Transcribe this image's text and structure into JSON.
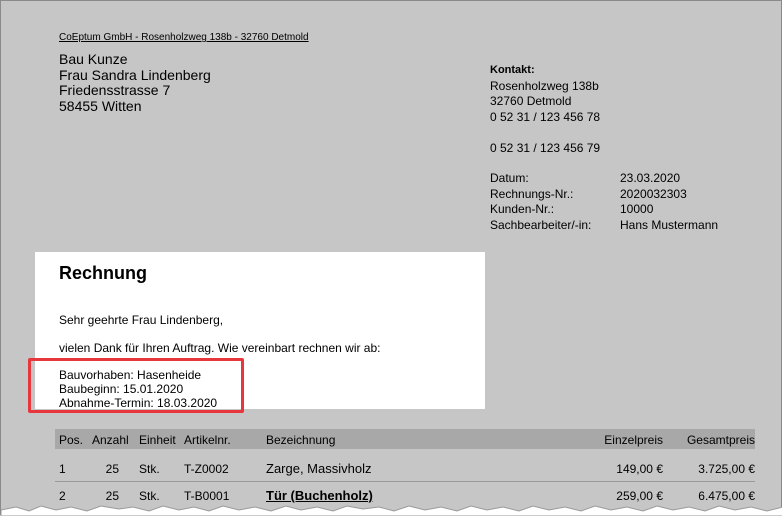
{
  "sender_line": "CoEptum GmbH - Rosenholzweg 138b - 32760 Detmold",
  "recipient": {
    "company": "Bau Kunze",
    "person": "Frau Sandra Lindenberg",
    "street": "Friedensstrasse 7",
    "city": "58455 Witten"
  },
  "contact": {
    "title": "Kontakt:",
    "street": "Rosenholzweg 138b",
    "city": "32760 Detmold",
    "phone": "0 52 31 / 123 456 78",
    "fax": "0 52 31 / 123 456 79"
  },
  "meta": [
    {
      "label": "Datum:",
      "value": "23.03.2020"
    },
    {
      "label": "Rechnungs-Nr.:",
      "value": "2020032303"
    },
    {
      "label": "Kunden-Nr.:",
      "value": "10000"
    },
    {
      "label": "Sachbearbeiter/-in:",
      "value": "Hans Mustermann"
    }
  ],
  "document": {
    "title": "Rechnung",
    "salutation": "Sehr geehrte Frau Lindenberg,",
    "intro": "vielen Dank für Ihren Auftrag. Wie vereinbart rechnen wir ab:",
    "project": "Bauvorhaben: Hasenheide",
    "start": "Baubeginn: 15.01.2020",
    "acceptance": "Abnahme-Termin: 18.03.2020"
  },
  "table": {
    "headers": {
      "pos": "Pos.",
      "anzahl": "Anzahl",
      "einheit": "Einheit",
      "artikel": "Artikelnr.",
      "bezeichnung": "Bezeichnung",
      "einzelpreis": "Einzelpreis",
      "gesamtpreis": "Gesamtpreis"
    },
    "rows": [
      {
        "pos": "1",
        "anzahl": "25",
        "einheit": "Stk.",
        "artikel": "T-Z0002",
        "bezeichnung": "Zarge, Massivholz",
        "einzelpreis": "149,00 €",
        "gesamtpreis": "3.725,00 €"
      },
      {
        "pos": "2",
        "anzahl": "25",
        "einheit": "Stk.",
        "artikel": "T-B0001",
        "bezeichnung": "Tür (Buchenholz)",
        "einzelpreis": "259,00 €",
        "gesamtpreis": "6.475,00 €"
      }
    ]
  },
  "colors": {
    "page_bg": "#c6c6c6",
    "highlight_border": "#e8363d",
    "table_header_bg": "#a8a8a8"
  }
}
